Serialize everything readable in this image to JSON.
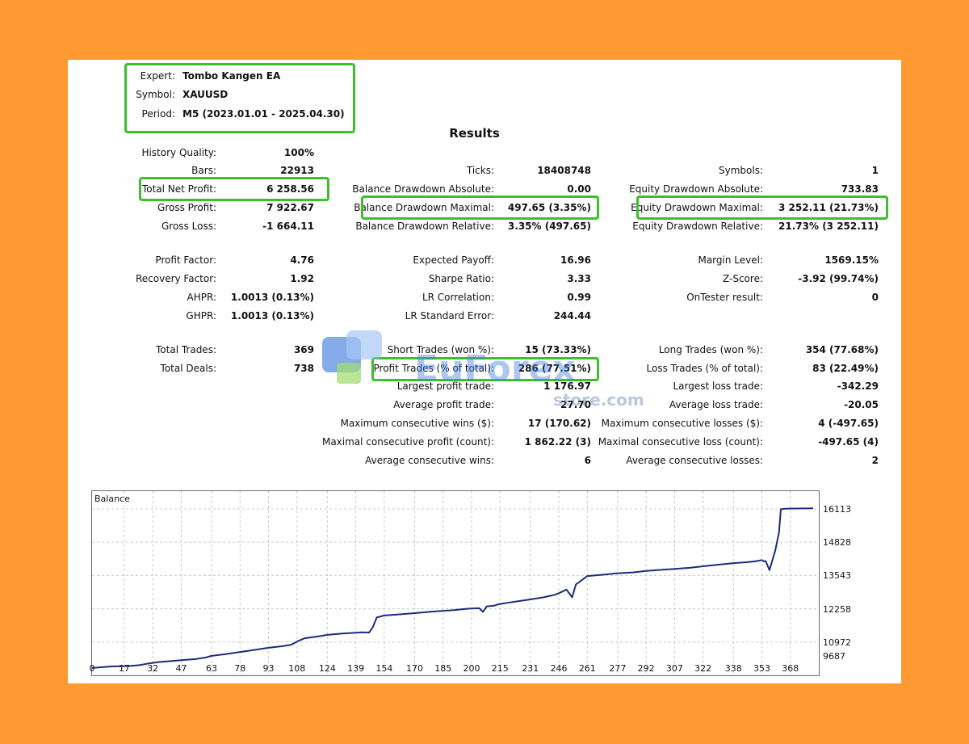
{
  "header": {
    "expert_label": "Expert:",
    "expert_value": "Tombo Kangen EA",
    "symbol_label": "Symbol:",
    "symbol_value": "XAUUSD",
    "period_label": "Period:",
    "period_value": "M5 (2023.01.01 - 2025.04.30)"
  },
  "results_title": "Results",
  "col1": [
    {
      "label": "History Quality:",
      "value": "100%"
    },
    {
      "label": "Bars:",
      "value": "22913"
    },
    {
      "label": "Total Net Profit:",
      "value": "6 258.56"
    },
    {
      "label": "Gross Profit:",
      "value": "7 922.67"
    },
    {
      "label": "Gross Loss:",
      "value": "-1 664.11"
    },
    {
      "label": "Profit Factor:",
      "value": "4.76"
    },
    {
      "label": "Recovery Factor:",
      "value": "1.92"
    },
    {
      "label": "AHPR:",
      "value": "1.0013 (0.13%)"
    },
    {
      "label": "GHPR:",
      "value": "1.0013 (0.13%)"
    },
    {
      "label": "Total Trades:",
      "value": "369"
    },
    {
      "label": "Total Deals:",
      "value": "738"
    }
  ],
  "col2": [
    {
      "label": "Ticks:",
      "value": "18408748"
    },
    {
      "label": "Balance Drawdown Absolute:",
      "value": "0.00"
    },
    {
      "label": "Balance Drawdown Maximal:",
      "value": "497.65 (3.35%)"
    },
    {
      "label": "Balance Drawdown Relative:",
      "value": "3.35% (497.65)"
    },
    {
      "label": "Expected Payoff:",
      "value": "16.96"
    },
    {
      "label": "Sharpe Ratio:",
      "value": "3.33"
    },
    {
      "label": "LR Correlation:",
      "value": "0.99"
    },
    {
      "label": "LR Standard Error:",
      "value": "244.44"
    },
    {
      "label": "Short Trades (won %):",
      "value": "15 (73.33%)"
    },
    {
      "label": "Profit Trades (% of total):",
      "value": "286 (77.51%)"
    },
    {
      "label": "Largest profit trade:",
      "value": "1 176.97"
    },
    {
      "label": "Average profit trade:",
      "value": "27.70"
    },
    {
      "label": "Maximum consecutive wins ($):",
      "value": "17 (170.62)"
    },
    {
      "label": "Maximal consecutive profit (count):",
      "value": "1 862.22 (3)"
    },
    {
      "label": "Average consecutive wins:",
      "value": "6"
    }
  ],
  "col3": [
    {
      "label": "Symbols:",
      "value": "1"
    },
    {
      "label": "Equity Drawdown Absolute:",
      "value": "733.83"
    },
    {
      "label": "Equity Drawdown Maximal:",
      "value": "3 252.11 (21.73%)"
    },
    {
      "label": "Equity Drawdown Relative:",
      "value": "21.73% (3 252.11)"
    },
    {
      "label": "Margin Level:",
      "value": "1569.15%"
    },
    {
      "label": "Z-Score:",
      "value": "-3.92 (99.74%)"
    },
    {
      "label": "OnTester result:",
      "value": "0"
    },
    {
      "label": "Long Trades (won %):",
      "value": "354 (77.68%)"
    },
    {
      "label": "Loss Trades (% of total):",
      "value": "83 (22.49%)"
    },
    {
      "label": "Largest loss trade:",
      "value": "-342.29"
    },
    {
      "label": "Average loss trade:",
      "value": "-20.05"
    },
    {
      "label": "Maximum consecutive losses ($):",
      "value": "4 (-497.65)"
    },
    {
      "label": "Maximal consecutive loss (count):",
      "value": "-497.65 (4)"
    },
    {
      "label": "Average consecutive losses:",
      "value": "2"
    }
  ],
  "watermark": {
    "main": "EuForex",
    "sub": "store.com"
  },
  "colors": {
    "background": "#FF9A33",
    "highlight": "#3DBE2C",
    "line": "#1F2A7A",
    "grid": "#C8C8C8"
  },
  "chart_data": {
    "type": "line",
    "title": "Balance",
    "x_ticks": [
      "0",
      "17",
      "32",
      "47",
      "63",
      "78",
      "93",
      "108",
      "124",
      "139",
      "154",
      "170",
      "185",
      "200",
      "215",
      "231",
      "246",
      "261",
      "277",
      "292",
      "307",
      "322",
      "338",
      "353",
      "368"
    ],
    "y_ticks": [
      "16113",
      "14828",
      "13543",
      "12258",
      "10972",
      "9687"
    ],
    "xlim": [
      0,
      383
    ],
    "ylim": [
      9687,
      16800
    ],
    "series": [
      {
        "x": [
          0,
          10,
          20,
          25,
          30,
          35,
          40,
          47,
          55,
          60,
          63,
          70,
          78,
          85,
          93,
          100,
          105,
          108,
          112,
          120,
          124,
          132,
          139,
          142,
          146,
          148,
          150,
          154,
          160,
          170,
          178,
          185,
          190,
          198,
          200,
          204,
          206,
          208,
          212,
          214,
          220,
          231,
          238,
          244,
          246,
          250,
          253,
          255,
          257,
          261,
          270,
          277,
          285,
          292,
          300,
          307,
          315,
          322,
          330,
          338,
          344,
          348,
          351,
          353,
          354,
          355,
          357,
          360,
          362,
          363,
          365,
          370,
          380
        ],
        "y": [
          9970,
          10030,
          10050,
          10080,
          10150,
          10200,
          10230,
          10270,
          10320,
          10380,
          10440,
          10500,
          10590,
          10660,
          10750,
          10810,
          10870,
          10990,
          11120,
          11200,
          11250,
          11300,
          11330,
          11350,
          11340,
          11550,
          11920,
          12000,
          12030,
          12090,
          12140,
          12180,
          12200,
          12260,
          12270,
          12280,
          12140,
          12350,
          12380,
          12430,
          12500,
          12620,
          12700,
          12800,
          12860,
          13000,
          12700,
          13200,
          13300,
          13520,
          13580,
          13630,
          13660,
          13720,
          13760,
          13800,
          13840,
          13900,
          13960,
          14020,
          14050,
          14080,
          14110,
          14140,
          14090,
          14100,
          13750,
          14500,
          15200,
          16100,
          16120,
          16130,
          16140
        ]
      }
    ]
  }
}
